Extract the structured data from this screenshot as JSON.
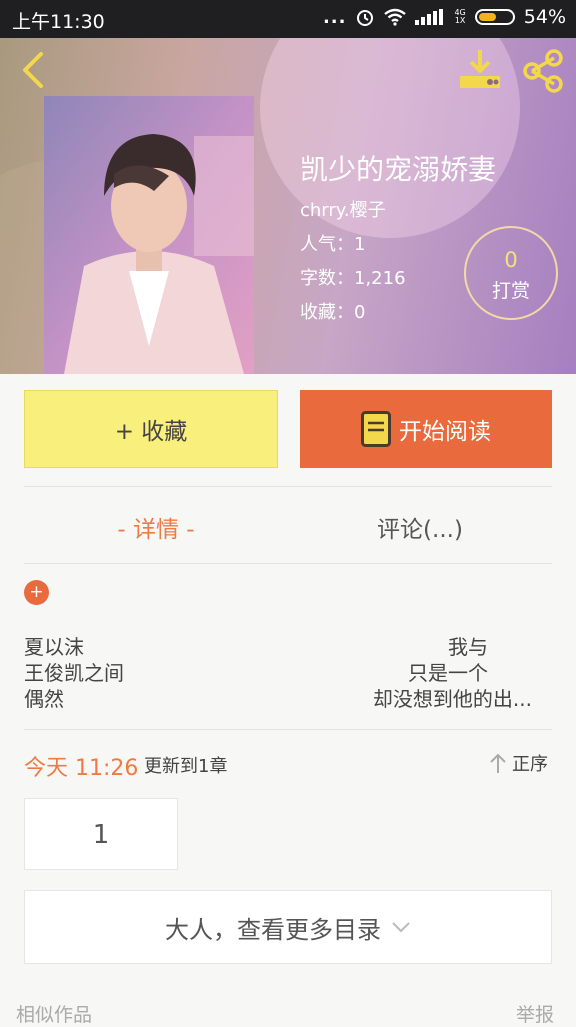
{
  "status_bar": {
    "time": "上午11:30",
    "signal_dots": "...",
    "network_top": "4G",
    "network_bottom": "1X",
    "battery_percent": "54%",
    "battery_level": 0.54
  },
  "header": {
    "icons": [
      "back-icon",
      "download-icon",
      "share-icon"
    ]
  },
  "book": {
    "title": "凯少的宠溺娇妻",
    "author": "chrry.樱子",
    "popularity": "人气：1",
    "word_count": "字数：1,216",
    "favorites": "收藏：0"
  },
  "tip": {
    "count": "0",
    "label": "打赏"
  },
  "actions": {
    "collect_label": "+ 收藏",
    "read_label": "开始阅读"
  },
  "tabs": {
    "detail": "- 详情 -",
    "comment": "评论(...)"
  },
  "description": {
    "expand": "+",
    "left_lines": [
      "夏以沫",
      "王俊凯之间",
      "偶然"
    ],
    "right_lines": [
      "我与",
      "只是一个",
      "却没想到他的出..."
    ]
  },
  "update": {
    "time": "今天 11:26",
    "text": "更新到1章",
    "sort_label": "正序"
  },
  "chapters": {
    "first": "1",
    "more_label": "大人，查看更多目录"
  },
  "footer": {
    "similar": "相似作品",
    "report": "举报"
  },
  "colors": {
    "accent": "#e96a3d",
    "collect_bg": "#f9ef7c",
    "icon_yellow": "#f3d84b"
  }
}
